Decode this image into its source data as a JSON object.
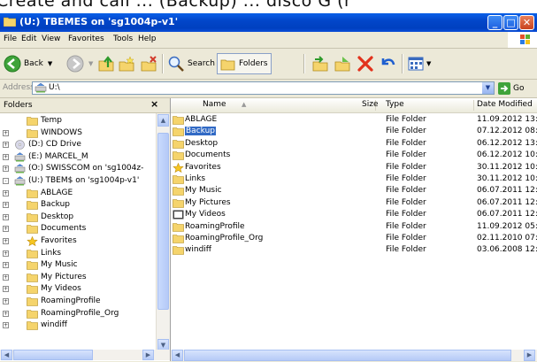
{
  "caption": "Create and call ... (Backup) ... disco G (r",
  "window": {
    "title": "(U:) TBEMES on 'sg1004p-v1'"
  },
  "menu": [
    "File",
    "Edit",
    "View",
    "Favorites",
    "Tools",
    "Help"
  ],
  "toolbar": {
    "back": "Back",
    "search": "Search",
    "folders": "Folders"
  },
  "address": {
    "label": "Address",
    "value": "U:\\",
    "go": "Go"
  },
  "folders_pane": {
    "title": "Folders",
    "close": "×",
    "items": [
      {
        "label": "Temp",
        "indent": 2,
        "expander": ""
      },
      {
        "label": "WINDOWS",
        "indent": 2,
        "expander": "+"
      },
      {
        "label": "(D:) CD Drive",
        "indent": 1,
        "expander": "+"
      },
      {
        "label": "(E:) MARCEL_M",
        "indent": 1,
        "expander": "+"
      },
      {
        "label": "(O:) SWISSCOM on 'sg1004z-",
        "indent": 1,
        "expander": "+"
      },
      {
        "label": "(U:) TBEM$ on 'sg1004p-v1'",
        "indent": 1,
        "expander": "-"
      },
      {
        "label": "ABLAGE",
        "indent": 2,
        "expander": "+"
      },
      {
        "label": "Backup",
        "indent": 2,
        "expander": "+"
      },
      {
        "label": "Desktop",
        "indent": 2,
        "expander": "+"
      },
      {
        "label": "Documents",
        "indent": 2,
        "expander": "+"
      },
      {
        "label": "Favorites",
        "indent": 2,
        "expander": "+"
      },
      {
        "label": "Links",
        "indent": 2,
        "expander": "+"
      },
      {
        "label": "My Music",
        "indent": 2,
        "expander": "+"
      },
      {
        "label": "My Pictures",
        "indent": 2,
        "expander": "+"
      },
      {
        "label": "My Videos",
        "indent": 2,
        "expander": "+"
      },
      {
        "label": "RoamingProfile",
        "indent": 2,
        "expander": "+"
      },
      {
        "label": "RoamingProfile_Org",
        "indent": 2,
        "expander": "+"
      },
      {
        "label": "windiff",
        "indent": 2,
        "expander": "+"
      }
    ]
  },
  "list": {
    "columns": {
      "name": "Name",
      "size": "Size",
      "type": "Type",
      "date": "Date Modified"
    },
    "rows": [
      {
        "name": "ABLAGE",
        "type": "File Folder",
        "date": "11.09.2012 13:"
      },
      {
        "name": "Backup",
        "type": "File Folder",
        "date": "07.12.2012 08:"
      },
      {
        "name": "Desktop",
        "type": "File Folder",
        "date": "06.12.2012 13:"
      },
      {
        "name": "Documents",
        "type": "File Folder",
        "date": "06.12.2012 10:"
      },
      {
        "name": "Favorites",
        "type": "File Folder",
        "date": "30.11.2012 10:"
      },
      {
        "name": "Links",
        "type": "File Folder",
        "date": "30.11.2012 10:"
      },
      {
        "name": "My Music",
        "type": "File Folder",
        "date": "06.07.2011 12:"
      },
      {
        "name": "My Pictures",
        "type": "File Folder",
        "date": "06.07.2011 12:"
      },
      {
        "name": "My Videos",
        "type": "File Folder",
        "date": "06.07.2011 12:"
      },
      {
        "name": "RoamingProfile",
        "type": "File Folder",
        "date": "11.09.2012 05:"
      },
      {
        "name": "RoamingProfile_Org",
        "type": "File Folder",
        "date": "02.11.2010 07:"
      },
      {
        "name": "windiff",
        "type": "File Folder",
        "date": "03.06.2008 12:"
      }
    ],
    "selected": "Backup"
  },
  "colors": {
    "title_blue": "#0246c9",
    "selection": "#316ac5",
    "folder": "#f5d46c"
  }
}
